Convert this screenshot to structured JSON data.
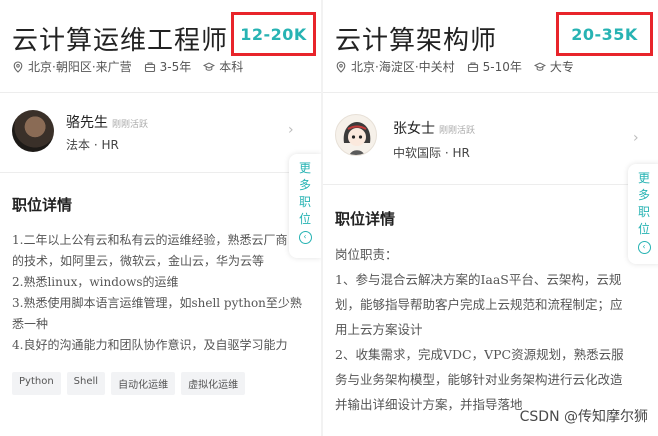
{
  "left": {
    "title": "云计算运维工程师",
    "salary": "12-20K",
    "location": "北京·朝阳区·来广营",
    "experience": "3-5年",
    "education": "本科",
    "hr": {
      "name": "骆先生",
      "status": "刚刚活跃",
      "company": "法本 · HR"
    },
    "side_tab": [
      "更",
      "多",
      "职",
      "位"
    ],
    "section_title": "职位详情",
    "lines": [
      "1.二年以上公有云和私有云的运维经验，熟悉云厂商",
      "的技术，如阿里云，微软云，金山云，华为云等",
      "2.熟悉linux，windows的运维",
      "3.熟悉使用脚本语言运维管理，如shell python至少熟",
      "悉一种",
      "4.良好的沟通能力和团队协作意识，及自驱学习能力"
    ],
    "tags": [
      "Python",
      "Shell",
      "自动化运维",
      "虚拟化运维"
    ]
  },
  "right": {
    "title": "云计算架构师",
    "salary": "20-35K",
    "location": "北京·海淀区·中关村",
    "experience": "5-10年",
    "education": "大专",
    "hr": {
      "name": "张女士",
      "status": "刚刚活跃",
      "company": "中软国际 · HR"
    },
    "side_tab": [
      "更",
      "多",
      "职",
      "位"
    ],
    "section_title": "职位详情",
    "lines": [
      "岗位职责：",
      "1、参与混合云解决方案的IaaS平台、云架构，云规",
      "划，能够指导帮助客户完成上云规范和流程制定；应",
      "用上云方案设计",
      "2、收集需求，完成VDC，VPC资源规划，熟悉云服",
      "务与业务架构模型，能够针对业务架构进行云化改造",
      "并输出详细设计方案，并指导落地"
    ]
  },
  "watermark": "CSDN @传知摩尔狮",
  "colors": {
    "salary": "#27b3b3",
    "highlight_box": "#e8242a"
  },
  "icons": {
    "location": "location-pin-icon",
    "experience": "briefcase-icon",
    "education": "graduation-cap-icon",
    "chevron": "chevron-right-icon"
  }
}
